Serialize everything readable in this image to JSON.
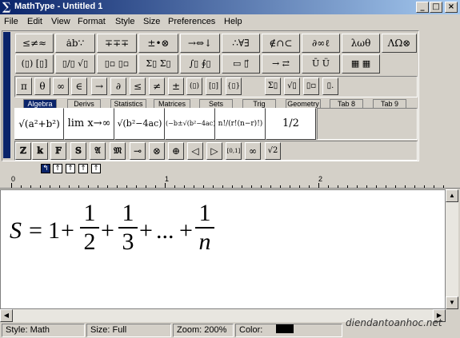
{
  "window": {
    "title": "MathType - Untitled 1",
    "minimize": "_",
    "maximize": "□",
    "close": "×"
  },
  "menu": [
    "File",
    "Edit",
    "View",
    "Format",
    "Style",
    "Size",
    "Preferences",
    "Help"
  ],
  "palette_row1": [
    "≤≠≈",
    "ȧb∵",
    "∓∓∓",
    "±•⊗",
    "→⇔↓",
    "∴∀∃",
    "∉∩⊂",
    "∂∞ℓ",
    "λωθ",
    "ΛΩ⊗"
  ],
  "palette_row2": [
    "(▯) [▯]",
    "▯/▯ √▯",
    "▯▫ ▯▫",
    "Σ▯ Σ▯",
    "∫▯ ∮▯",
    "▭ ▯⃗",
    "→ ⇄",
    "Ū Ü",
    "▦ ▦"
  ],
  "symbols_row": [
    "π",
    "θ",
    "∞",
    "∈",
    "→",
    "∂",
    "≤",
    "≠",
    "±",
    "(▯)",
    "[▯]",
    "{▯}",
    "Σ▯",
    "√▯",
    "▯▫",
    "▯."
  ],
  "tabs": [
    "Algebra",
    "Derivs",
    "Statistics",
    "Matrices",
    "Sets",
    "Trig",
    "Geometry",
    "Tab 8",
    "Tab 9"
  ],
  "templates": [
    "√(a²+b²)",
    "lim x→∞",
    "√(b²−4ac)",
    "(−b±√(b²−4ac))/2a",
    "n!/(r!(n−r)!)",
    "1/2"
  ],
  "bottom_row": [
    "ℤ",
    "𝕜",
    "𝔽",
    "𝕊",
    "𝔄",
    "𝔐",
    "⊸",
    "⊗",
    "⊕",
    "◁",
    "▷",
    "[0,1]",
    "∞",
    "√2"
  ],
  "nav_buttons": [
    "↰",
    "↑",
    "↑",
    "↑",
    "↑"
  ],
  "ruler": {
    "labels": [
      "0",
      "1",
      "2"
    ]
  },
  "equation": {
    "lhs": "S",
    "eq": "=",
    "one": "1",
    "plus": "+",
    "frac1_num": "1",
    "frac1_den": "2",
    "frac2_num": "1",
    "frac2_den": "3",
    "dots": "...",
    "fracn_num": "1",
    "fracn_den": "n"
  },
  "status": {
    "style": "Style: Math",
    "size": "Size: Full",
    "zoom": "Zoom: 200%",
    "color_label": "Color:",
    "color": "#000000"
  },
  "watermark": "diendantoanhoc.net"
}
